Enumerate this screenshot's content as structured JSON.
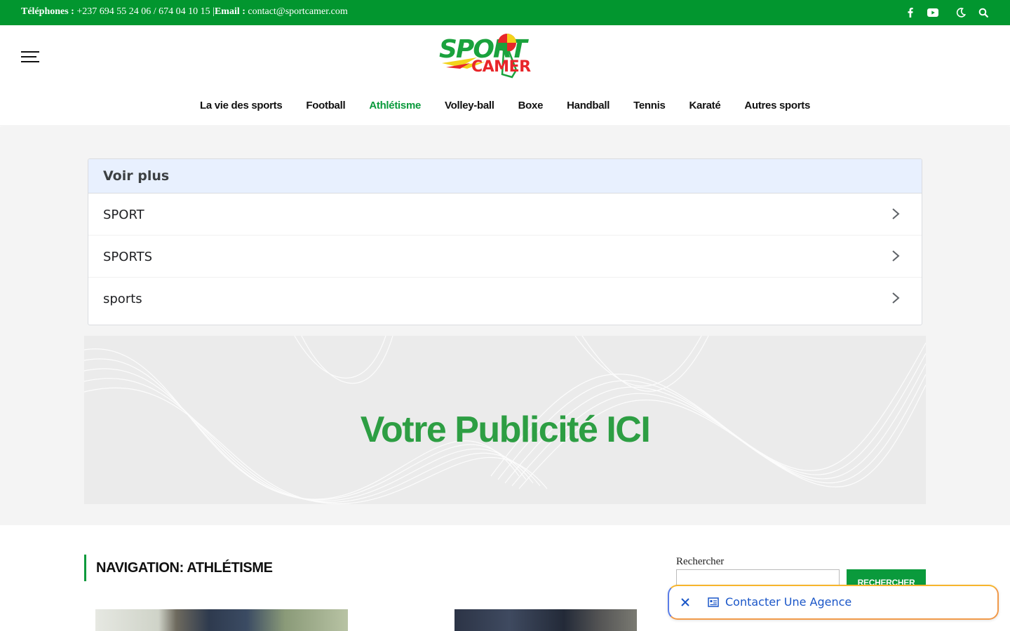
{
  "topbar": {
    "phones_label": "Téléphones :",
    "phones_value": " +237 694 55 24 06 / 674 04 10 15 |",
    "email_label": "Email :",
    "email_value": " contact@sportcamer.com",
    "icons": [
      "facebook-icon",
      "youtube-icon",
      "moon-icon",
      "search-icon"
    ]
  },
  "header": {
    "logo_line1": "SPORT",
    "logo_line2": "CAMER",
    "nav": [
      {
        "label": "La vie des sports"
      },
      {
        "label": "Football"
      },
      {
        "label": "Athlétisme",
        "active": true
      },
      {
        "label": "Volley-ball"
      },
      {
        "label": "Boxe"
      },
      {
        "label": "Handball"
      },
      {
        "label": "Tennis"
      },
      {
        "label": "Karaté"
      },
      {
        "label": "Autres sports"
      }
    ]
  },
  "voir_plus": {
    "title": "Voir plus",
    "items": [
      "SPORT",
      "SPORTS",
      "sports"
    ]
  },
  "ad": {
    "text": "Votre Publicité ICI"
  },
  "section": {
    "title": "NAVIGATION: ATHLÉTISME"
  },
  "sidebar": {
    "search_label": "Rechercher",
    "search_button": "RECHERCHER"
  },
  "agency_prompt": {
    "label": "Contacter Une Agence"
  },
  "colors": {
    "brand_green": "#02962f",
    "accent_green": "#0a9a3c",
    "link_blue": "#1a56c8"
  }
}
